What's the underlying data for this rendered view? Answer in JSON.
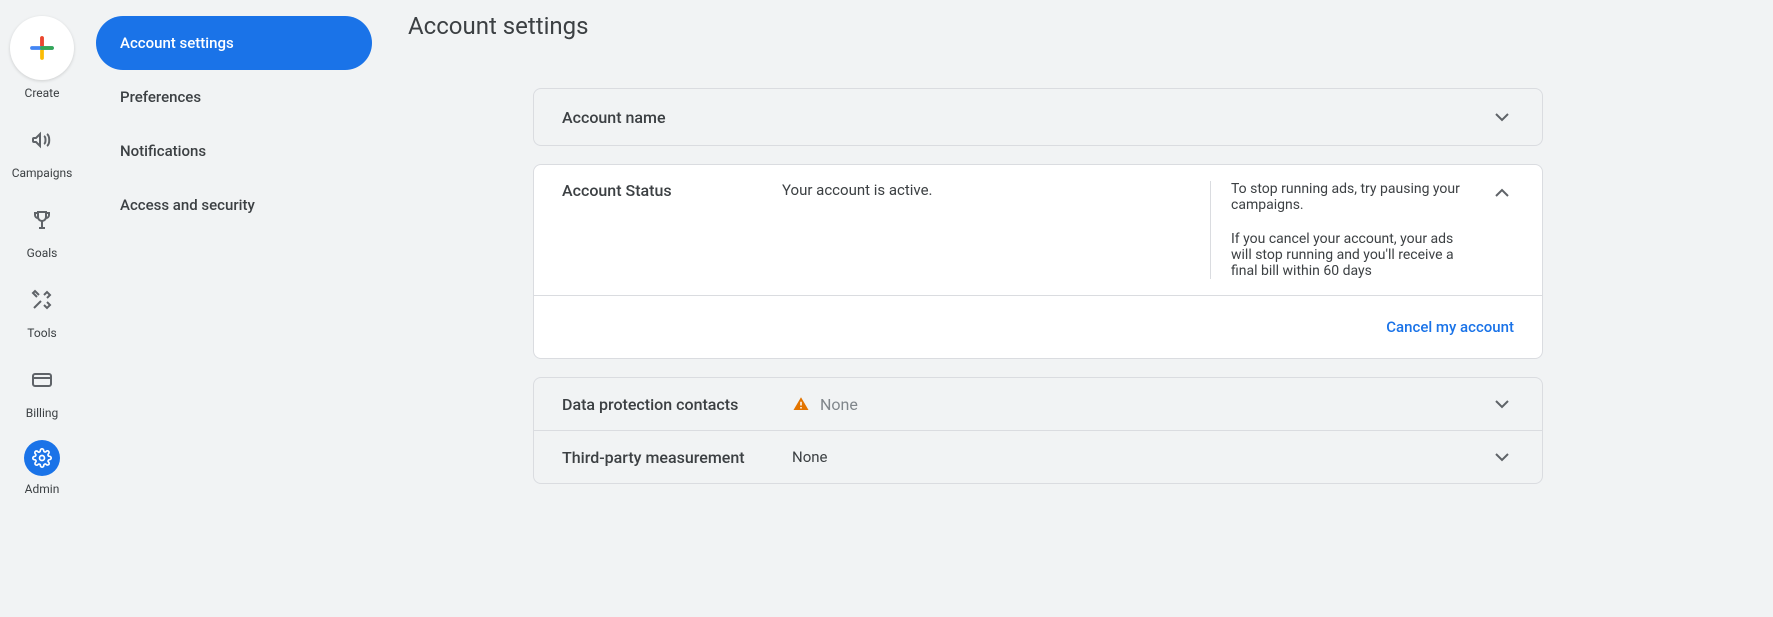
{
  "rail": {
    "create": "Create",
    "campaigns": "Campaigns",
    "goals": "Goals",
    "tools": "Tools",
    "billing": "Billing",
    "admin": "Admin"
  },
  "sidenav": {
    "account_settings": "Account settings",
    "preferences": "Preferences",
    "notifications": "Notifications",
    "access_security": "Access and security"
  },
  "page": {
    "title": "Account settings"
  },
  "cards": {
    "account_name": {
      "title": "Account name"
    },
    "account_status": {
      "title": "Account Status",
      "status_text": "Your account is active.",
      "tip1": "To stop running ads, try pausing your campaigns.",
      "tip2": "If you cancel your account, your ads will stop running and you'll receive a final bill within 60 days",
      "cancel_label": "Cancel my account"
    },
    "data_protection": {
      "title": "Data protection contacts",
      "value": "None"
    },
    "third_party": {
      "title": "Third-party measurement",
      "value": "None"
    }
  }
}
